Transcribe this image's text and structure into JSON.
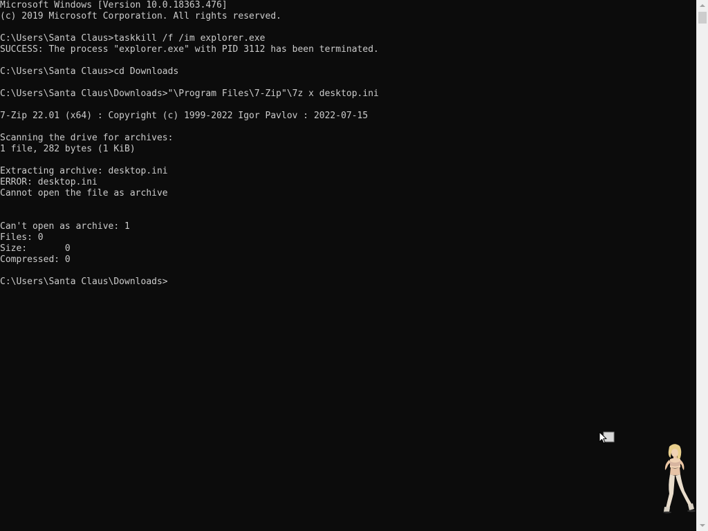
{
  "console": {
    "lines": [
      "Microsoft Windows [Version 10.0.18363.476]",
      "(c) 2019 Microsoft Corporation. All rights reserved.",
      "",
      "C:\\Users\\Santa Claus>taskkill /f /im explorer.exe",
      "SUCCESS: The process \"explorer.exe\" with PID 3112 has been terminated.",
      "",
      "C:\\Users\\Santa Claus>cd Downloads",
      "",
      "C:\\Users\\Santa Claus\\Downloads>\"\\Program Files\\7-Zip\"\\7z x desktop.ini",
      "",
      "7-Zip 22.01 (x64) : Copyright (c) 1999-2022 Igor Pavlov : 2022-07-15",
      "",
      "Scanning the drive for archives:",
      "1 file, 282 bytes (1 KiB)",
      "",
      "Extracting archive: desktop.ini",
      "ERROR: desktop.ini",
      "Cannot open the file as archive",
      "",
      "",
      "Can't open as archive: 1",
      "Files: 0",
      "Size:       0",
      "Compressed: 0",
      "",
      "C:\\Users\\Santa Claus\\Downloads>"
    ]
  },
  "colors": {
    "background": "#0c0c0c",
    "foreground": "#cccccc",
    "scrollbar_track": "#f0f0f0",
    "scrollbar_thumb": "#cdcdcd"
  },
  "icons": {
    "cursor": "mouse-pointer-icon",
    "mascot": "desktop-character-mascot"
  }
}
